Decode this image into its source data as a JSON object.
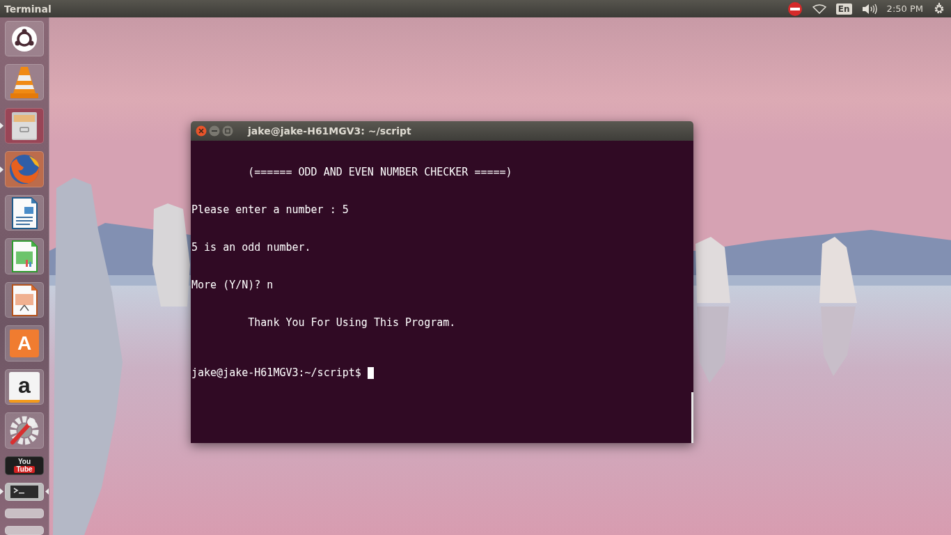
{
  "top_panel": {
    "app_title": "Terminal",
    "keyboard_layout": "En",
    "clock": "2:50 PM"
  },
  "launcher": [
    {
      "kind": "ubuntu",
      "running": false,
      "focused": false
    },
    {
      "kind": "vlc",
      "running": false,
      "focused": false
    },
    {
      "kind": "files",
      "running": true,
      "focused": false
    },
    {
      "kind": "firefox",
      "running": true,
      "focused": false
    },
    {
      "kind": "writer",
      "running": false,
      "focused": false
    },
    {
      "kind": "calc",
      "running": false,
      "focused": false
    },
    {
      "kind": "impress",
      "running": false,
      "focused": false
    },
    {
      "kind": "software",
      "glyph": "A",
      "running": false,
      "focused": false
    },
    {
      "kind": "amazon",
      "glyph": "a",
      "running": false,
      "focused": false
    },
    {
      "kind": "settings",
      "running": false,
      "focused": false
    },
    {
      "kind": "youtube",
      "label_top": "You",
      "label_bottom": "Tube",
      "running": false,
      "focused": false
    },
    {
      "kind": "terminal",
      "running": true,
      "focused": true
    },
    {
      "kind": "folded",
      "running": false,
      "focused": false
    },
    {
      "kind": "folded",
      "running": false,
      "focused": false
    }
  ],
  "terminal_window": {
    "title": "jake@jake-H61MGV3: ~/script",
    "output": "\n\n         (====== ODD AND EVEN NUMBER CHECKER =====)\n\n\nPlease enter a number : 5\n\n\n5 is an odd number.\n\n\nMore (Y/N)? n\n\n\n         Thank You For Using This Program.\n\n\n\n",
    "prompt": "jake@jake-H61MGV3:~/script$ "
  }
}
